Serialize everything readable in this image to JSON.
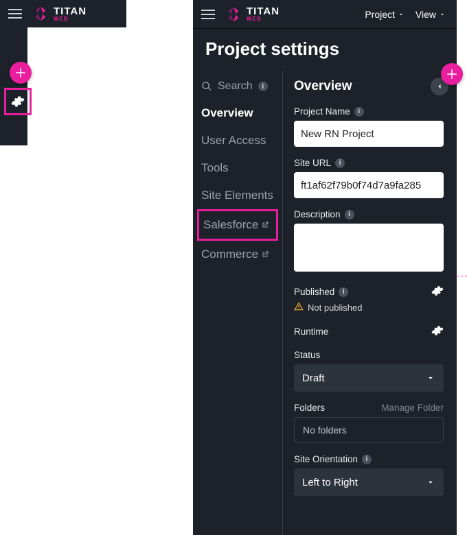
{
  "brand": {
    "title": "TITAN",
    "sub": "WEB"
  },
  "topmenu": {
    "project": "Project",
    "view": "View"
  },
  "page_title": "Project settings",
  "nav": {
    "search": "Search",
    "items": {
      "overview": "Overview",
      "user_access": "User Access",
      "tools": "Tools",
      "site_elements": "Site Elements",
      "salesforce": "Salesforce",
      "commerce": "Commerce"
    }
  },
  "content": {
    "title": "Overview",
    "project_name_label": "Project Name",
    "project_name_value": "New RN Project",
    "site_url_label": "Site URL",
    "site_url_value": "ft1af62f79b0f74d7a9fa285",
    "description_label": "Description",
    "description_value": "",
    "published_label": "Published",
    "published_status": "Not published",
    "runtime_label": "Runtime",
    "status_label": "Status",
    "status_value": "Draft",
    "folders_label": "Folders",
    "folders_manage": "Manage Folder",
    "folders_value": "No folders",
    "orientation_label": "Site Orientation",
    "orientation_value": "Left to Right"
  }
}
